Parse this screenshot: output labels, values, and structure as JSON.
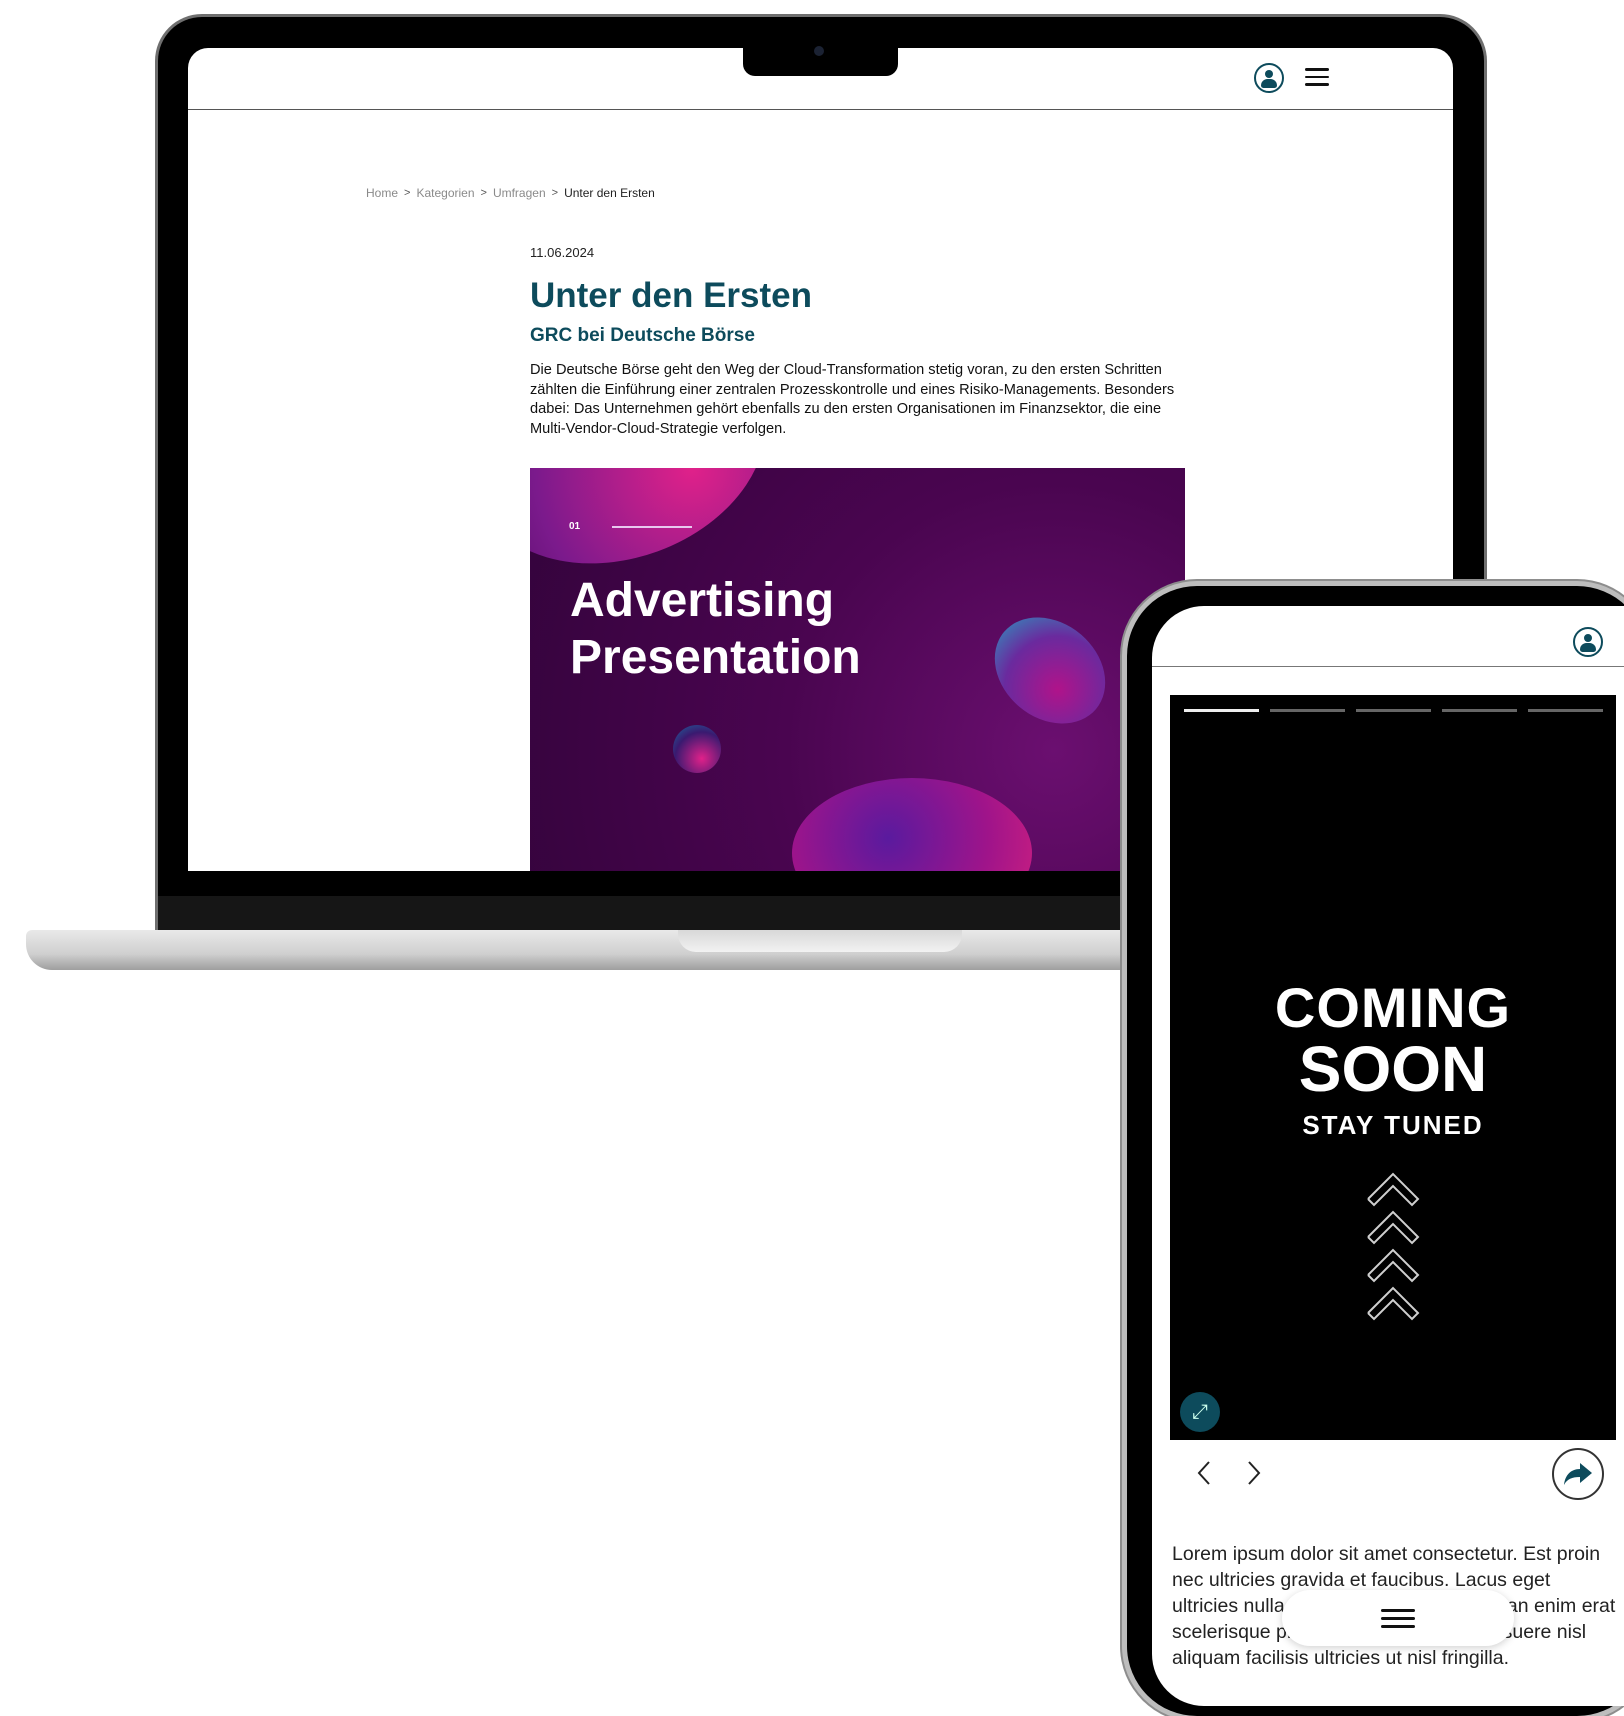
{
  "laptop": {
    "breadcrumb": [
      {
        "label": "Home"
      },
      {
        "label": "Kategorien"
      },
      {
        "label": "Umfragen"
      },
      {
        "label": "Unter den Ersten"
      }
    ],
    "breadcrumb_separator": ">",
    "article": {
      "date": "11.06.2024",
      "title": "Unter den Ersten",
      "subtitle": "GRC bei Deutsche Börse",
      "lede": "Die Deutsche Börse geht den Weg der Cloud-Transformation stetig voran, zu den ersten Schritten zählten die Einführung einer zentralen Prozesskontrolle und eines Risiko-Managements. Besonders dabei: Das Unternehmen gehört ebenfalls zu den ersten Organisationen im Finanzsektor, die eine Multi-Vendor-Cloud-Strategie verfolgen."
    },
    "hero": {
      "number": "01",
      "title_line1": "Advertising",
      "title_line2": "Presentation"
    },
    "header_icons": [
      "user-icon",
      "hamburger-menu-icon"
    ]
  },
  "phone": {
    "story": {
      "progress_total": 5,
      "progress_active_index": 0,
      "line1": "COMING",
      "line2": "SOON",
      "line3": "STAY TUNED"
    },
    "body_text": "Lorem ipsum dolor sit amet consectetur. Est proin nec ultricies gravida et faucibus. Lacus eget ultricies nulla consectetur sed. Accumsan enim erat scelerisque pretium lobortis. Augue posuere nisl aliquam facilisis ultricies ut nisl fringilla.",
    "icons": [
      "user-icon",
      "expand-icon",
      "chevron-left-icon",
      "chevron-right-icon",
      "share-icon",
      "hamburger-menu-icon"
    ]
  },
  "colors": {
    "brand_teal": "#0d4b5c",
    "hero_purple": "#4a0550",
    "accent_pink": "#e0218a"
  }
}
